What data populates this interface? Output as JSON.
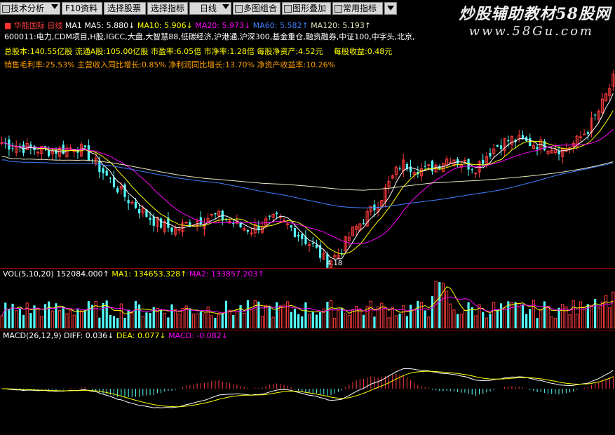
{
  "toolbar": {
    "buttons": [
      "技术分析",
      "F10资料",
      "选择股票",
      "选择指标",
      "日线",
      "多图组合",
      "图形叠加",
      "常用指标"
    ]
  },
  "watermark": {
    "logo_text": "炒股辅助教材58股网",
    "url": "www.58Gu.com"
  },
  "header": {
    "stock_name": "华能国际",
    "period": "日线",
    "ma_label": "MA1",
    "ma5": "MA5: 5.880↓",
    "ma10": "MA10: 5.906↓",
    "ma20": "MA20: 5.973↓",
    "ma60": "MA60: 5.582↑",
    "ma120": "MA120: 5.193↑"
  },
  "concepts": "600011:电力,CDM项目,H股,IGCC,大盘,大智慧88,低碳经济,沪港通,沪深300,基金重仓,融资融券,中证100,中字头,北京,",
  "fundamentals": {
    "total_shares": "总股本:140.55亿股",
    "float_shares": "流通A股:105.00亿股",
    "pe": "市盈率:6.05倍",
    "pb": "市净率:1.28倍",
    "nav": "每股净资产:4.52元",
    "eps": "每股收益:0.48元"
  },
  "ratios": {
    "gross_margin": "销售毛利率:25.53%",
    "revenue_growth": "主营收入同比增长:0.85%",
    "profit_growth": "净利润同比增长:13.70%",
    "roe": "净资产收益率:10.26%"
  },
  "price_low_label": "4.18",
  "volume": {
    "title": "VOL(5,10,20)",
    "value": "152084.000↑",
    "ma1": "MA1: 134653.328↑",
    "ma2": "MA2: 133857.203↑"
  },
  "macd": {
    "title": "MACD(26,12,9)",
    "diff": "DIFF: 0.036↓",
    "dea": "DEA: 0.077↓",
    "macd": "MACD: -0.082↓"
  },
  "colors": {
    "up": "#ff3c3c",
    "down": "#54ffff",
    "ma5": "#ffffff",
    "ma10": "#ffff00",
    "ma20": "#ff00ff",
    "ma60": "#4080ff",
    "ma120": "#e8e8c0",
    "separator": "#a00000"
  },
  "chart_data": {
    "type": "candlestick",
    "price_trend": [
      5.9,
      5.85,
      5.82,
      5.8,
      5.78,
      5.8,
      5.85,
      5.7,
      5.5,
      5.3,
      5.1,
      4.95,
      4.8,
      4.7,
      4.65,
      4.75,
      4.8,
      4.85,
      4.8,
      4.7,
      4.65,
      4.75,
      4.8,
      4.7,
      4.55,
      4.4,
      4.18,
      4.3,
      4.6,
      4.8,
      5.0,
      5.3,
      5.6,
      5.55,
      5.5,
      5.6,
      5.7,
      5.6,
      5.55,
      5.75,
      5.9,
      5.95,
      5.9,
      5.88,
      5.85,
      5.8,
      5.9,
      6.1,
      6.4,
      6.8
    ],
    "low_point": 4.18
  }
}
